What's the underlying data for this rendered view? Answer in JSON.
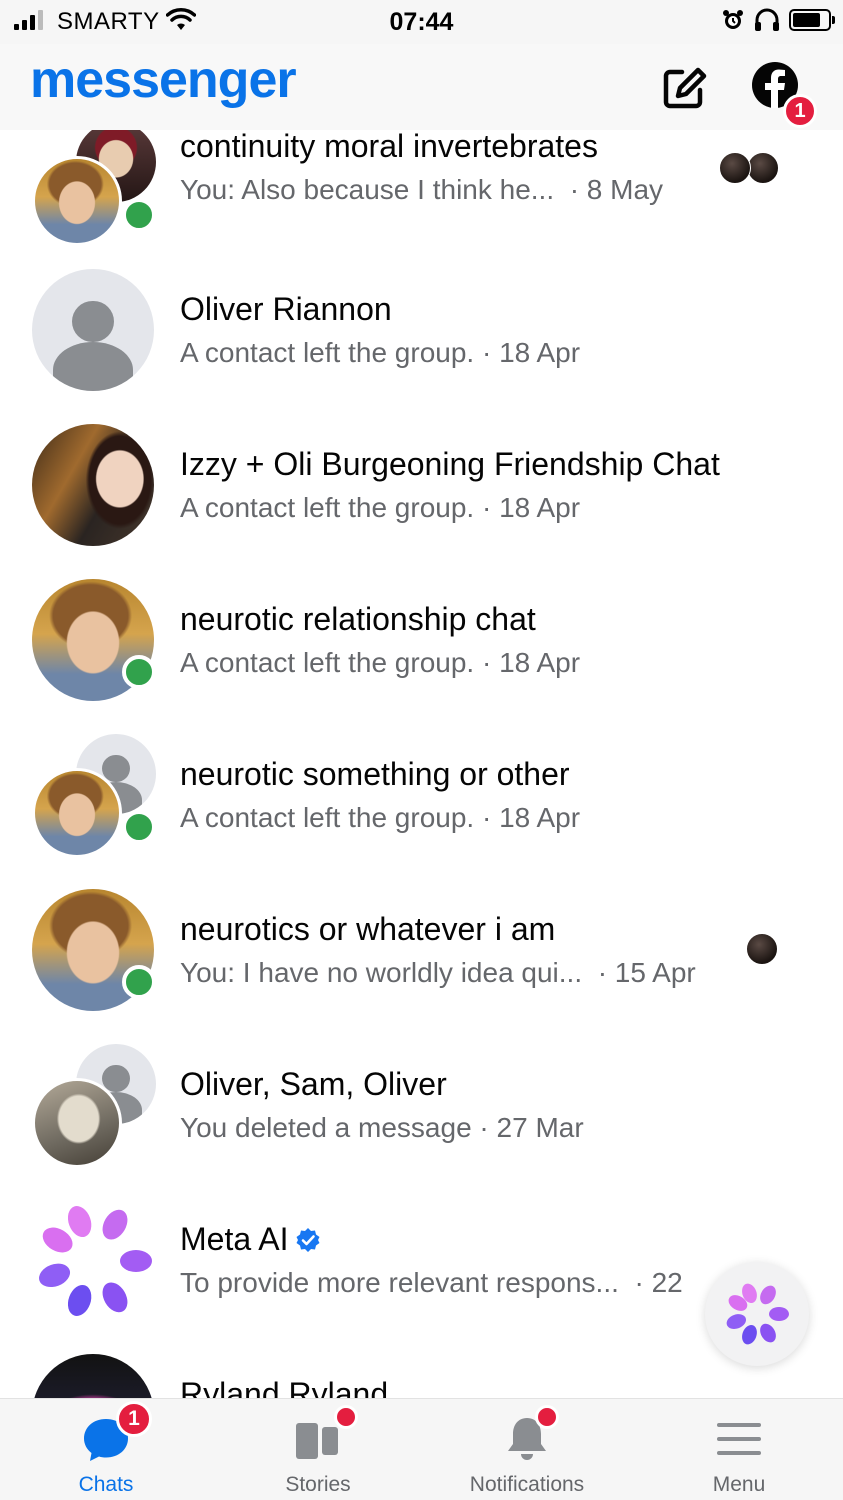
{
  "status_bar": {
    "carrier": "SMARTY",
    "time": "07:44"
  },
  "header": {
    "logo": "messenger",
    "facebook_badge": "1",
    "icons": [
      "compose-icon",
      "facebook-icon"
    ]
  },
  "conversations": [
    {
      "title": "continuity moral invertebrates",
      "preview": "You: Also because I think he...",
      "sep": "·",
      "date": "8 May",
      "online": true,
      "avatar": "group-photos",
      "seen_by": 2
    },
    {
      "title": "Oliver Riannon",
      "preview": "A contact left the group.",
      "sep": "·",
      "date": "18 Apr",
      "online": false,
      "avatar": "default-person"
    },
    {
      "title": "Izzy + Oli Burgeoning Friendship Chat",
      "preview": "A contact left the group.",
      "sep": "·",
      "date": "18 Apr",
      "online": false,
      "avatar": "photo"
    },
    {
      "title": "neurotic relationship chat",
      "preview": "A contact left the group.",
      "sep": "·",
      "date": "18 Apr",
      "online": true,
      "avatar": "photo"
    },
    {
      "title": "neurotic something or other",
      "preview": "A contact left the group.",
      "sep": "·",
      "date": "18 Apr",
      "online": true,
      "avatar": "group-default"
    },
    {
      "title": "neurotics or whatever i am",
      "preview": "You: I have no worldly idea qui...",
      "sep": "·",
      "date": "15 Apr",
      "online": true,
      "avatar": "photo",
      "seen_by": 1
    },
    {
      "title": "Oliver, Sam, Oliver",
      "preview": "You deleted a message",
      "sep": "·",
      "date": "27 Mar",
      "online": false,
      "avatar": "group-default"
    },
    {
      "title": "Meta AI",
      "preview": "To provide more relevant respons...",
      "sep": "·",
      "date": "22 ",
      "online": false,
      "avatar": "meta-ai",
      "verified": true
    },
    {
      "title": "Ryland Ryland",
      "preview": "",
      "sep": "",
      "date": "",
      "online": false,
      "avatar": "photo"
    }
  ],
  "tabbar": {
    "tabs": [
      {
        "label": "Chats",
        "icon": "chat-bubble-icon",
        "active": true,
        "badge": "1"
      },
      {
        "label": "Stories",
        "icon": "stories-icon",
        "active": false,
        "dot": true
      },
      {
        "label": "Notifications",
        "icon": "bell-icon",
        "active": false,
        "dot": true
      },
      {
        "label": "Menu",
        "icon": "hamburger-menu-icon",
        "active": false
      }
    ]
  },
  "colors": {
    "brand": "#0a73e8",
    "online": "#31a24c",
    "badge": "#e41e3f",
    "secondary_text": "#65676b"
  }
}
